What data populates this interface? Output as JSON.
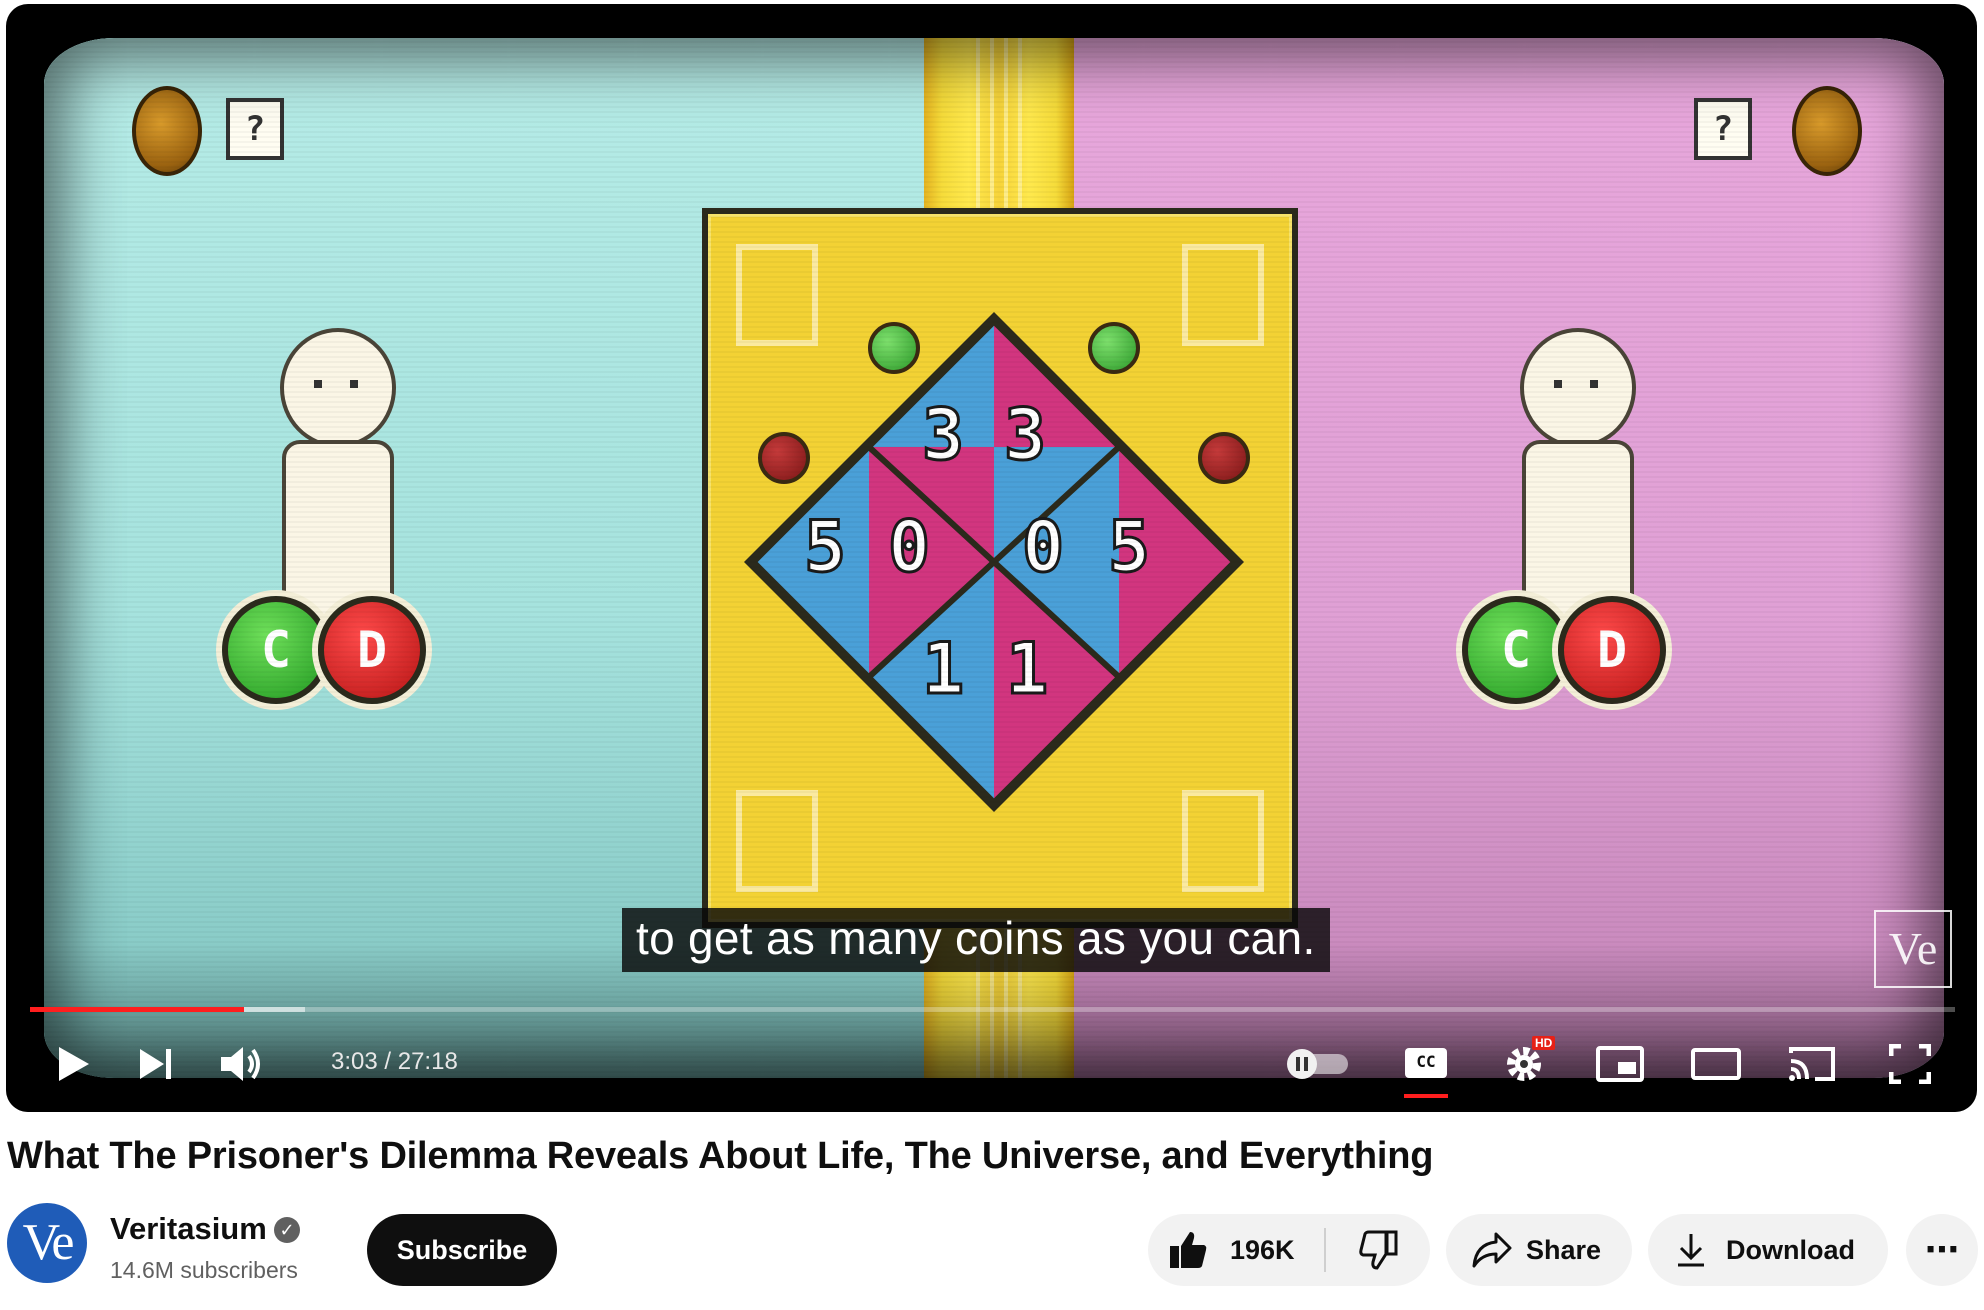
{
  "video": {
    "caption": "to get as many coins as you can.",
    "watermark": "Ve",
    "board_numbers": {
      "top": [
        "3",
        "3"
      ],
      "left": [
        "5",
        "0"
      ],
      "right": [
        "0",
        "5"
      ],
      "bottom": [
        "1",
        "1"
      ]
    },
    "player_button_letters": {
      "cooperate": "C",
      "defect": "D"
    },
    "card_glyph": "?",
    "progress": {
      "played_fraction": 0.111,
      "buffered_fraction": 0.143
    },
    "time_current": "3:03",
    "time_separator": " / ",
    "time_total": "27:18",
    "hd_badge": "HD",
    "cc_label": "CC"
  },
  "title": "What The Prisoner's Dilemma Reveals About Life, The Universe, and Everything",
  "channel": {
    "avatar_text": "Ve",
    "name": "Veritasium",
    "verified_mark": "✓",
    "subscribers": "14.6M subscribers"
  },
  "actions": {
    "subscribe": "Subscribe",
    "likes": "196K",
    "share": "Share",
    "download": "Download",
    "more": "⋯"
  },
  "colors": {
    "progress_red": "#ff1e1e",
    "panel_left": "#a6e3de",
    "panel_right": "#e0a0d5",
    "board_yellow": "#f3d234",
    "triangle_blue": "#4aa0d8",
    "triangle_pink": "#d2357f",
    "avatar_blue": "#1f5cb8"
  }
}
